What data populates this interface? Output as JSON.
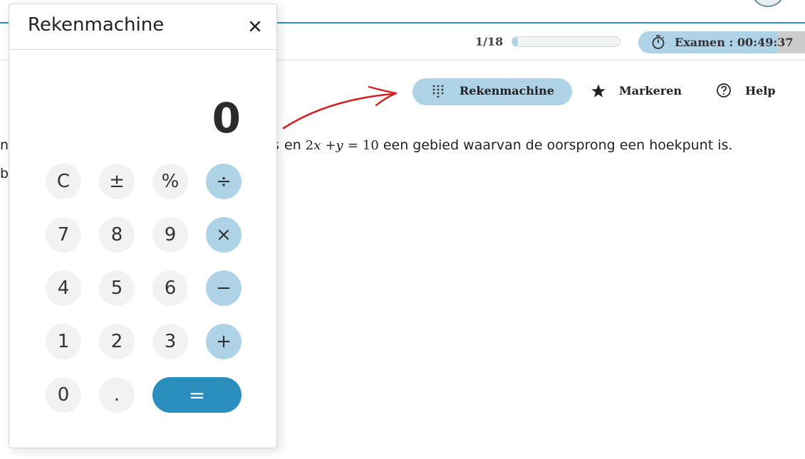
{
  "status": {
    "progress_label": "1/18",
    "progress_fraction": 0.055,
    "timer_text": "Examen : 00:49:37"
  },
  "toolbar": {
    "calculator_label": "Rekenmachine",
    "mark_label": "Markeren",
    "help_label": "Help"
  },
  "question": {
    "left_fragment_1": "n",
    "left_fragment_2": "b",
    "hidden_s": "s",
    "word_en": "en",
    "coef": "2",
    "var_x": "x",
    "plus": "+",
    "var_y": "y",
    "equals": "=",
    "rhs": "10",
    "tail": "een gebied waarvan de oorsprong een hoekpunt is."
  },
  "calculator": {
    "title": "Rekenmachine",
    "display": "0",
    "keys": {
      "clear": "C",
      "sign": "±",
      "percent": "%",
      "divide": "÷",
      "seven": "7",
      "eight": "8",
      "nine": "9",
      "multiply": "×",
      "four": "4",
      "five": "5",
      "six": "6",
      "minus": "−",
      "one": "1",
      "two": "2",
      "three": "3",
      "plus": "+",
      "zero": "0",
      "decimal": ".",
      "equals": "="
    }
  },
  "colors": {
    "accent": "#2a8fbf",
    "light_accent": "#aed3e6",
    "annotation_arrow": "#d42020"
  }
}
